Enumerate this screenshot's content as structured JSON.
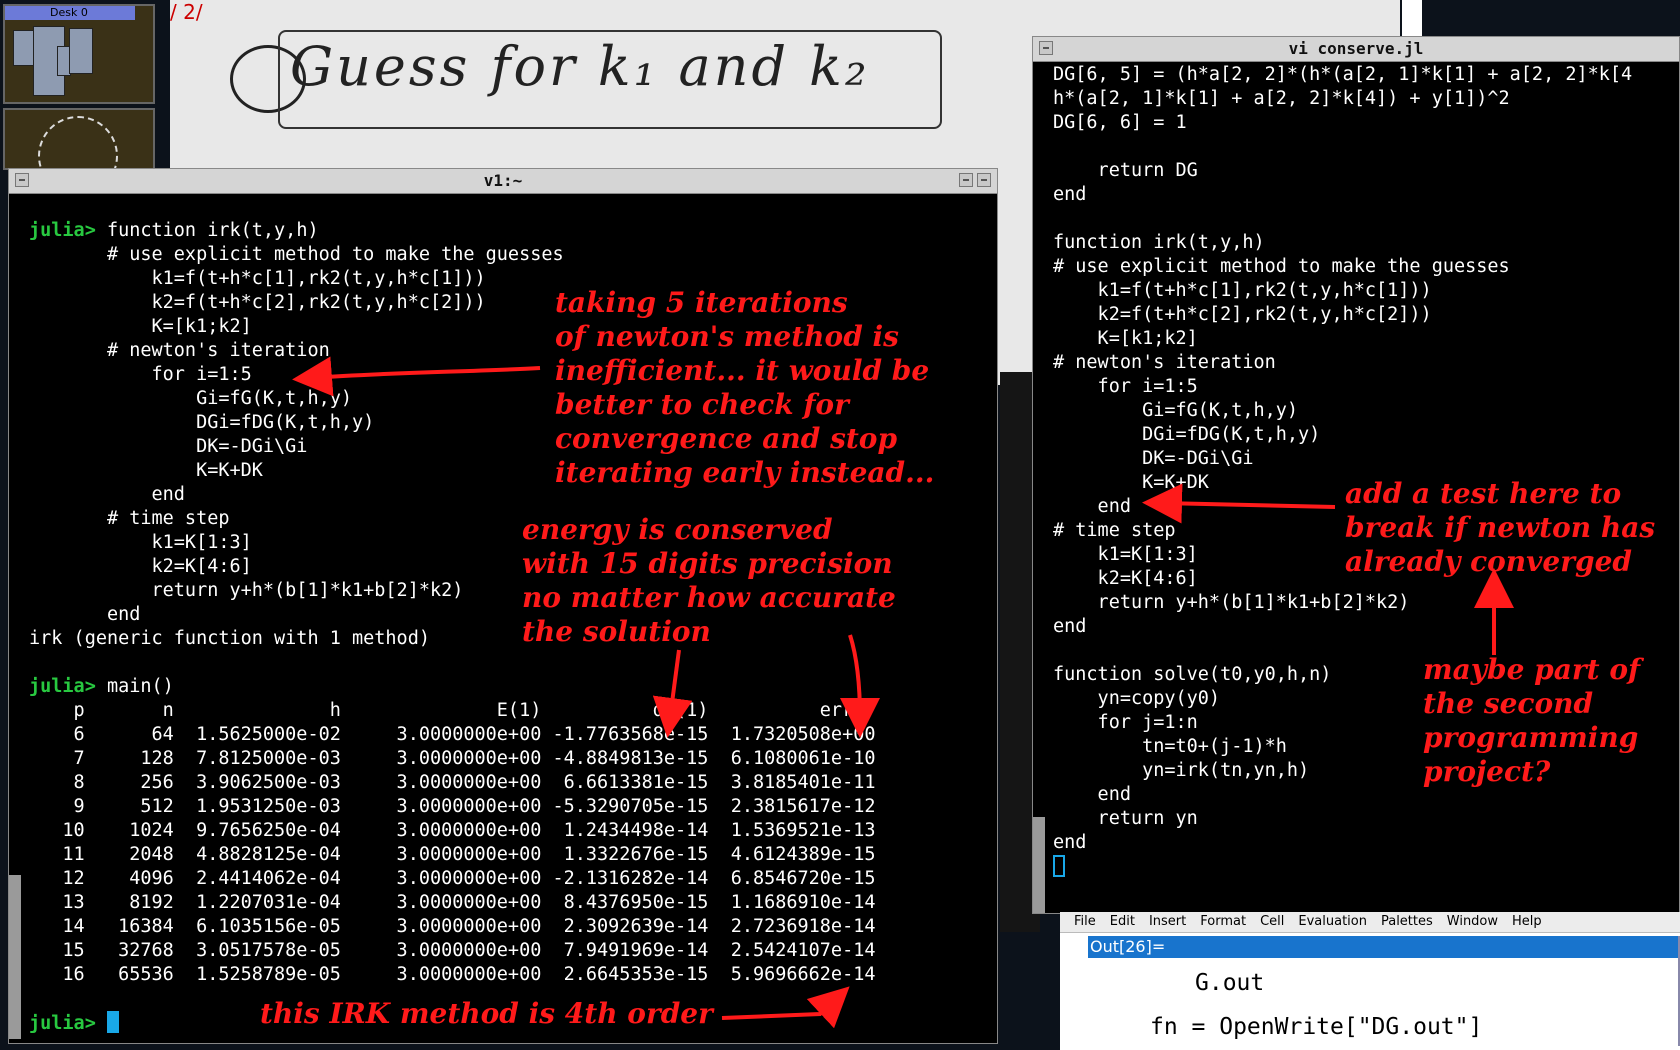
{
  "desktop": {
    "pager_label": "Desk 0"
  },
  "background_scan": {
    "top_text": "/ 2/      ",
    "heading": "Guess for  k₁  and  k₂"
  },
  "left_window": {
    "title": "v1:~",
    "lines": [
      "",
      "julia> function irk(t,y,h)",
      "       # use explicit method to make the guesses",
      "           k1=f(t+h*c[1],rk2(t,y,h*c[1]))",
      "           k2=f(t+h*c[2],rk2(t,y,h*c[2]))",
      "           K=[k1;k2]",
      "       # newton's iteration",
      "           for i=1:5",
      "               Gi=fG(K,t,h,y)",
      "               DGi=fDG(K,t,h,y)",
      "               DK=-DGi\\Gi",
      "               K=K+DK",
      "           end",
      "       # time step",
      "           k1=K[1:3]",
      "           k2=K[4:6]",
      "           return y+h*(b[1]*k1+b[2]*k2)",
      "       end",
      "irk (generic function with 1 method)",
      "",
      "julia> main()",
      "    p       n              h              E(1)          dE(1)          error",
      "    6      64  1.5625000e-02     3.0000000e+00 -1.7763568e-15  1.7320508e+00",
      "    7     128  7.8125000e-03     3.0000000e+00 -4.8849813e-15  6.1080061e-10",
      "    8     256  3.9062500e-03     3.0000000e+00  6.6613381e-15  3.8185401e-11",
      "    9     512  1.9531250e-03     3.0000000e+00 -5.3290705e-15  2.3815617e-12",
      "   10    1024  9.7656250e-04     3.0000000e+00  1.2434498e-14  1.5369521e-13",
      "   11    2048  4.8828125e-04     3.0000000e+00  1.3322676e-15  4.6124389e-15",
      "   12    4096  2.4414062e-04     3.0000000e+00 -2.1316282e-14  6.8546720e-15",
      "   13    8192  1.2207031e-04     3.0000000e+00  8.4376950e-15  1.1686910e-14",
      "   14   16384  6.1035156e-05     3.0000000e+00  2.3092639e-14  2.7236918e-14",
      "   15   32768  3.0517578e-05     3.0000000e+00  7.9491969e-14  2.5424107e-14",
      "   16   65536  1.5258789e-05     3.0000000e+00  2.6645353e-15  5.9696662e-14",
      "",
      "julia> "
    ]
  },
  "right_window": {
    "title": "vi conserve.jl",
    "lines": [
      "DG[6, 5] = (h*a[2, 2]*(h*(a[2, 1]*k[1] + a[2, 2]*k[4",
      "h*(a[2, 1]*k[1] + a[2, 2]*k[4]) + y[1])^2",
      "DG[6, 6] = 1",
      "",
      "    return DG",
      "end",
      "",
      "function irk(t,y,h)",
      "# use explicit method to make the guesses",
      "    k1=f(t+h*c[1],rk2(t,y,h*c[1]))",
      "    k2=f(t+h*c[2],rk2(t,y,h*c[2]))",
      "    K=[k1;k2]",
      "# newton's iteration",
      "    for i=1:5",
      "        Gi=fG(K,t,h,y)",
      "        DGi=fDG(K,t,h,y)",
      "        DK=-DGi\\Gi",
      "        K=K+DK",
      "    end",
      "# time step",
      "    k1=K[1:3]",
      "    k2=K[4:6]",
      "    return y+h*(b[1]*k1+b[2]*k2)",
      "end",
      "",
      "function solve(t0,y0,h,n)",
      "    yn=copy(y0)",
      "    for j=1:n",
      "        tn=t0+(j-1)*h",
      "        yn=irk(tn,yn,h)",
      "    end",
      "    return yn",
      "end"
    ]
  },
  "annotations": {
    "newton": "taking 5 iterations\nof newton's method is\ninefficient... it would be\nbetter to check for\nconvergence and stop\niterating early instead...",
    "energy": "energy is conserved\nwith 15 digits precision\nno matter how accurate\nthe solution",
    "order": "this IRK method is 4th order",
    "break_test": "add a test here to\nbreak if newton has\nalready converged",
    "project": "maybe part of\nthe second\nprogramming\nproject?"
  },
  "mathematica": {
    "menu": [
      "File",
      "Edit",
      "Insert",
      "Format",
      "Cell",
      "Evaluation",
      "Palettes",
      "Window",
      "Help"
    ],
    "out_label": "Out[26]=",
    "output": "G.out",
    "next_line": "fn = OpenWrite[\"DG.out\"]"
  },
  "colors": {
    "prompt": "#28c840",
    "annotation": "#ff1a1a",
    "cursor": "#19a8e8"
  }
}
